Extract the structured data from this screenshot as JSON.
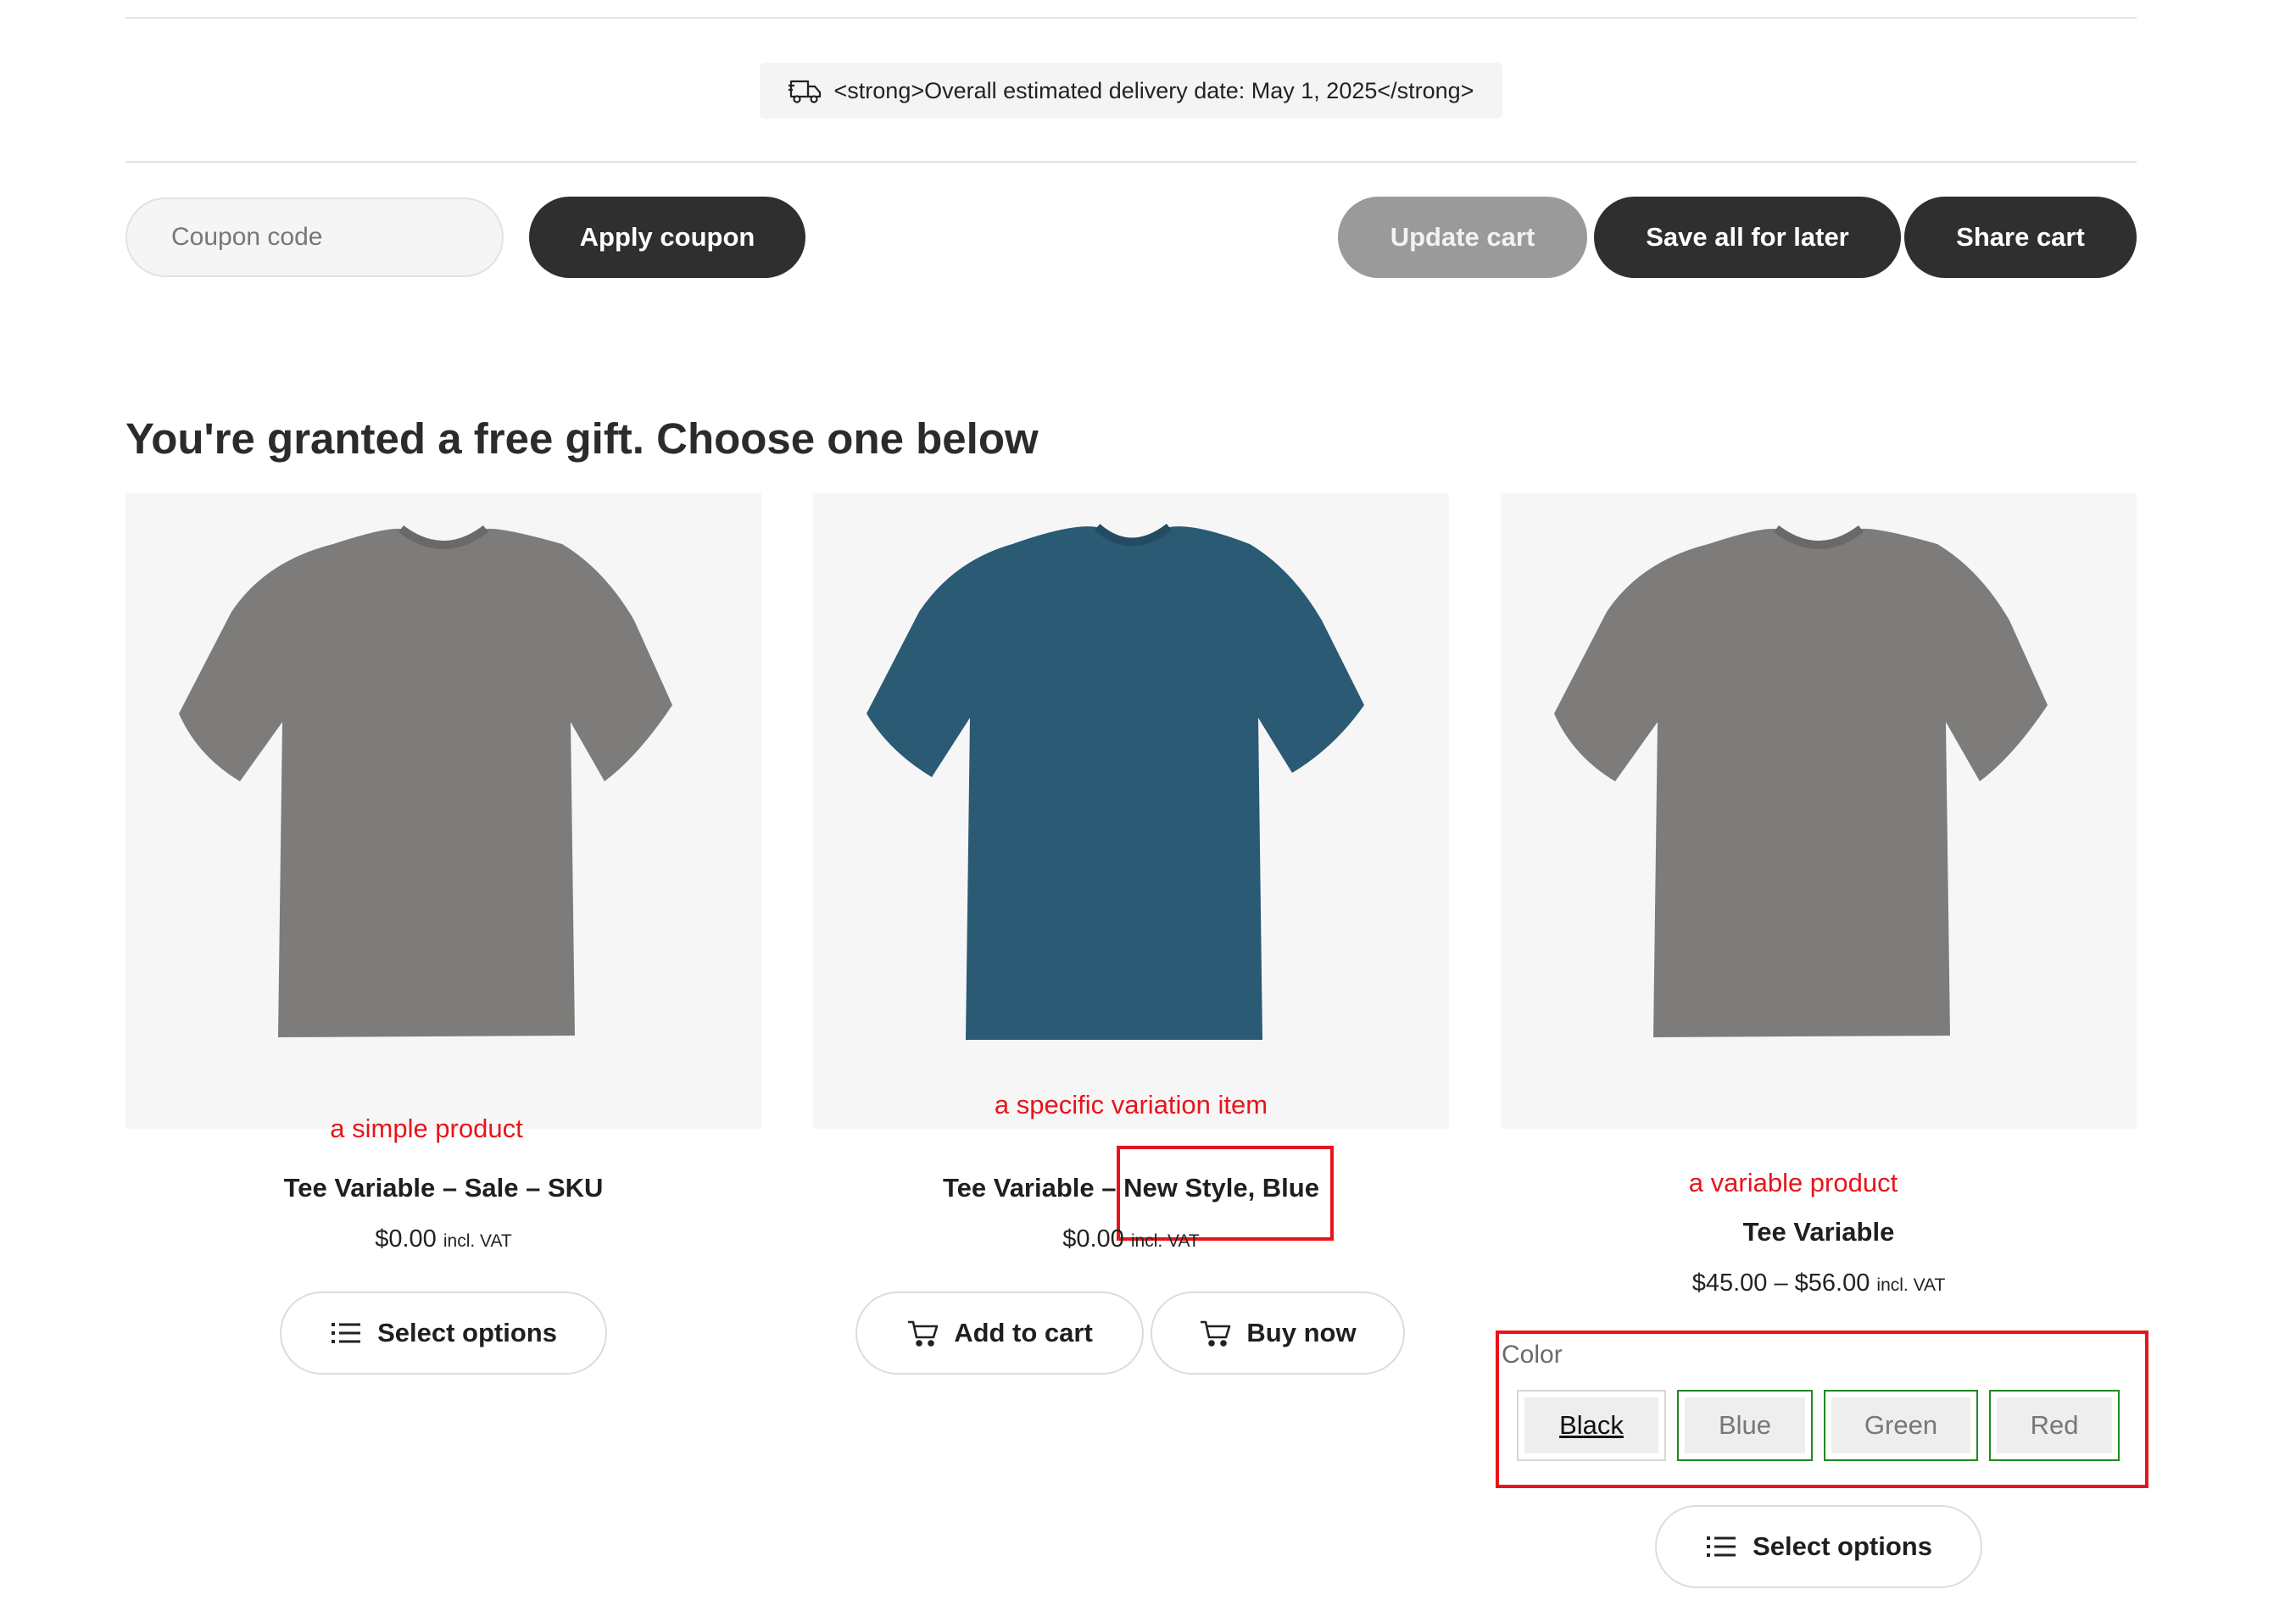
{
  "delivery_notice": {
    "icon": "delivery-truck-icon",
    "text": "<strong>Overall estimated delivery date: May 1, 2025</strong>"
  },
  "cart_actions": {
    "coupon_placeholder": "Coupon code",
    "apply_coupon": "Apply coupon",
    "update_cart": "Update cart",
    "save_all_for_later": "Save all for later",
    "share_cart": "Share cart"
  },
  "gift_section": {
    "heading": "You're granted a free gift. Choose one below",
    "products": [
      {
        "note": "a simple product",
        "image": "tshirt-grey",
        "title": "Tee Variable – Sale – SKU",
        "price": "$0.00",
        "tax": "incl. VAT",
        "button": "Select options",
        "button_icon": "list-icon"
      },
      {
        "note": "a specific variation item",
        "image": "tshirt-blue",
        "title_prefix": "Tee Variable –",
        "title_highlight": "New Style, Blue",
        "price": "$0.00",
        "tax": "incl. VAT",
        "add_to_cart": "Add to cart",
        "buy_now": "Buy now",
        "button_icon": "cart-icon"
      },
      {
        "note": "a variable product",
        "image": "tshirt-grey",
        "title": "Tee Variable",
        "price": "$45.00 – $56.00",
        "tax": "incl. VAT",
        "attribute_label": "Color",
        "options": [
          "Black",
          "Blue",
          "Green",
          "Red"
        ],
        "selected_option": "Black",
        "button": "Select options",
        "button_icon": "list-icon"
      }
    ]
  },
  "colors": {
    "annotation_red": "#e8141b",
    "swatch_border_green": "#1f8a1f",
    "button_dark": "#2f2f2f",
    "button_grey": "#9a9a9a",
    "tee_grey": "#7e7c7a",
    "tee_blue": "#2a5a74"
  }
}
